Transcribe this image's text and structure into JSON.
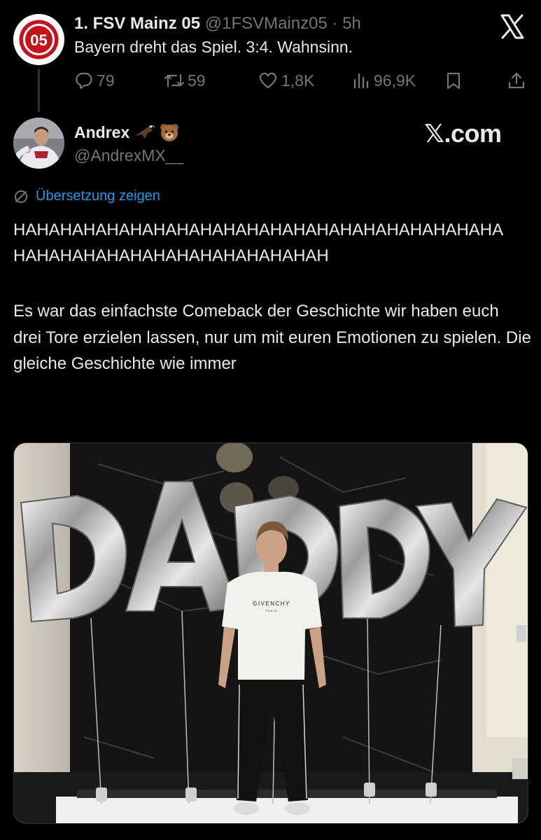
{
  "parent_tweet": {
    "display_name": "1. FSV Mainz 05",
    "handle": "@1FSVMainz05",
    "separator": "·",
    "time": "5h",
    "text": "Bayern dreht das Spiel. 3:4. Wahnsinn.",
    "stats": {
      "replies": "79",
      "retweets": "59",
      "likes": "1,8K",
      "views": "96,9K"
    }
  },
  "reply_tweet": {
    "display_name": "Andrex",
    "handle": "@AndrexMX__",
    "translate_label": "Übersetzung zeigen",
    "text_line1": "HAHAHAHAHAHAHAHAHAHAHAHAHAHAHAHAHAHAHAHAHA",
    "text_line2": "HAHAHAHAHAHAHAHAHAHAHAHAHAH",
    "text_body": "Es war das einfachste Comeback der Geschichte wir haben euch drei Tore erzielen lassen, nur um mit euren Emotionen zu spielen. Die gleiche Geschichte wie immer"
  },
  "watermark": "𝕏.com",
  "photo": {
    "balloon_letters": [
      "D",
      "A",
      "D",
      "D",
      "Y"
    ],
    "shirt_brand": "GIVENCHY",
    "shirt_sub": "PARIS"
  },
  "colors": {
    "background": "#000000",
    "text": "#e7e9ea",
    "muted": "#71767b",
    "link": "#1d9bf0",
    "mainz_red": "#c3141e"
  }
}
